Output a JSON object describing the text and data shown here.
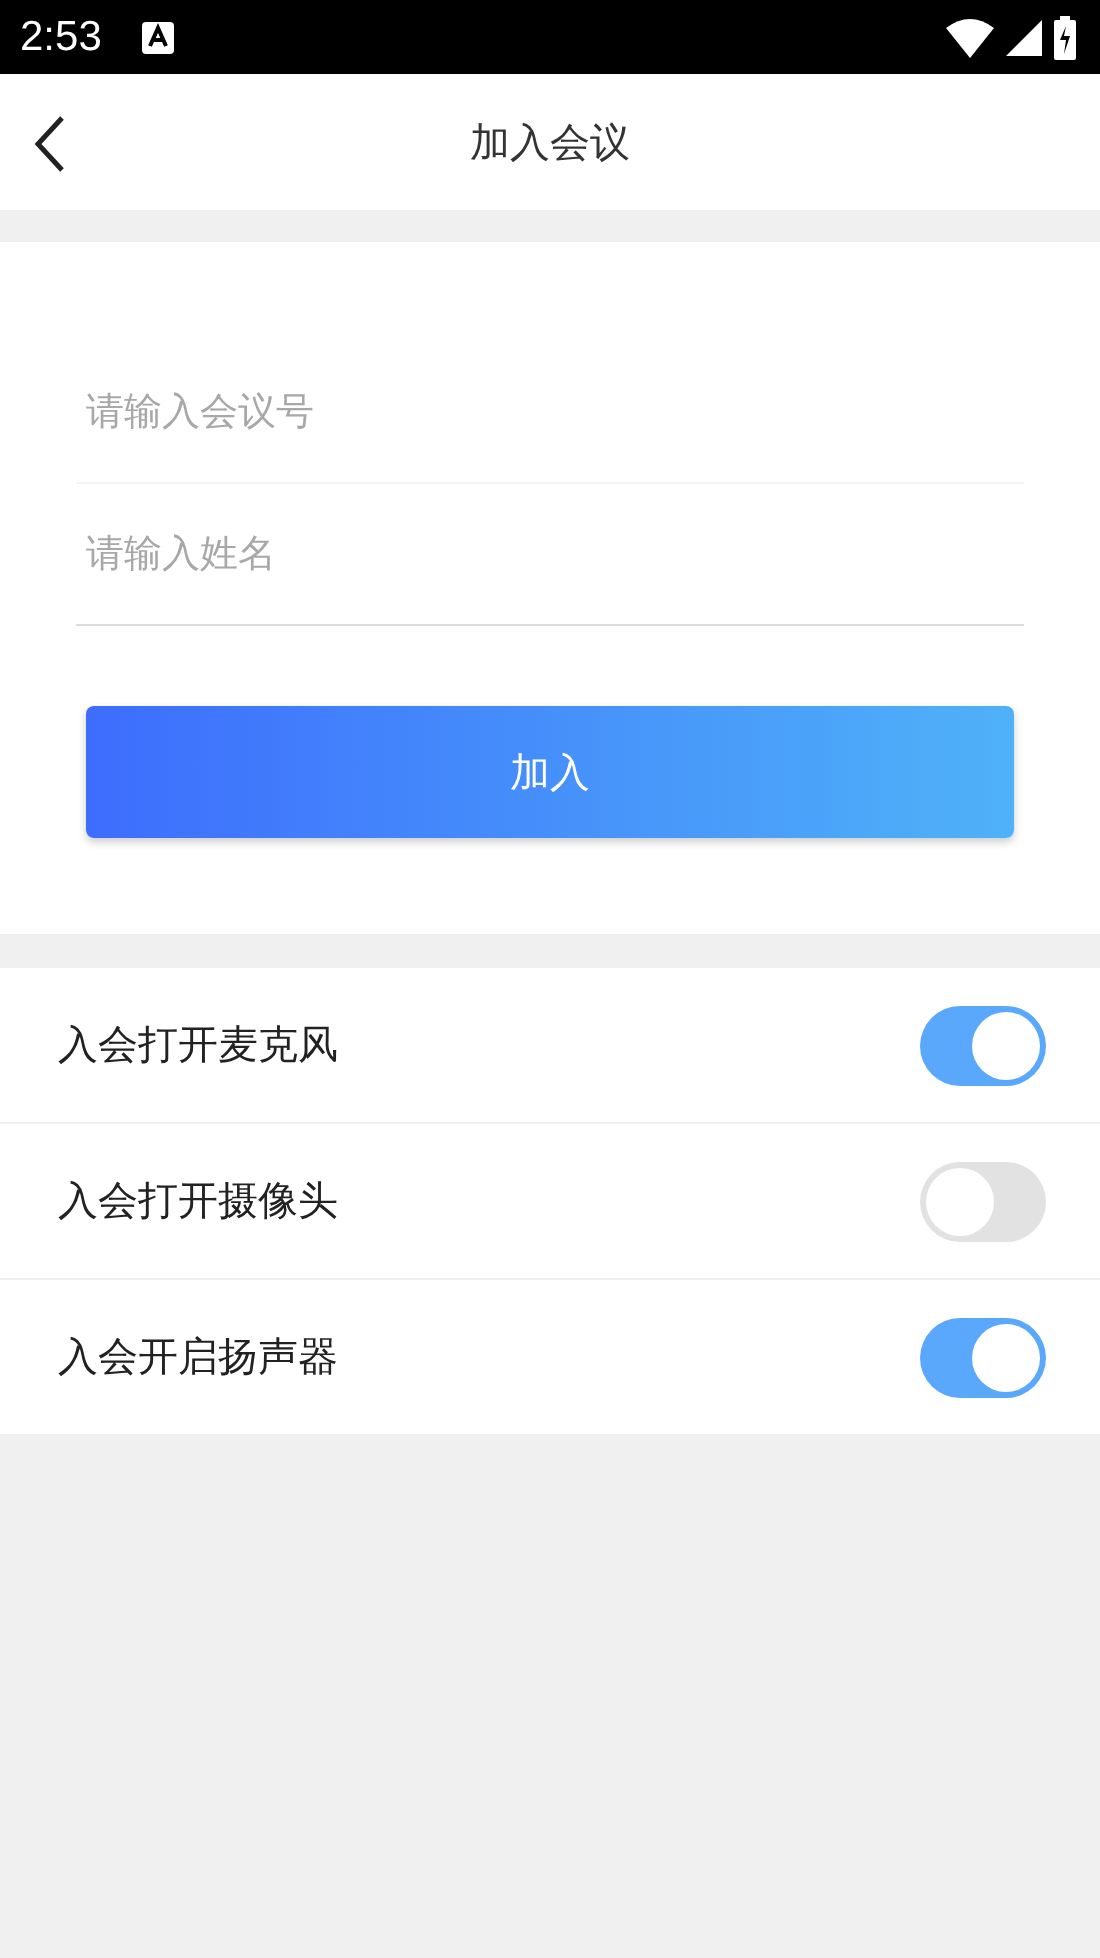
{
  "status_bar": {
    "time": "2:53"
  },
  "header": {
    "title": "加入会议"
  },
  "form": {
    "fields": [
      {
        "placeholder": "请输入会议号"
      },
      {
        "placeholder": "请输入姓名"
      }
    ],
    "join_button": "加入"
  },
  "options": [
    {
      "label": "入会打开麦克风",
      "on": true
    },
    {
      "label": "入会打开摄像头",
      "on": false
    },
    {
      "label": "入会开启扬声器",
      "on": true
    }
  ]
}
